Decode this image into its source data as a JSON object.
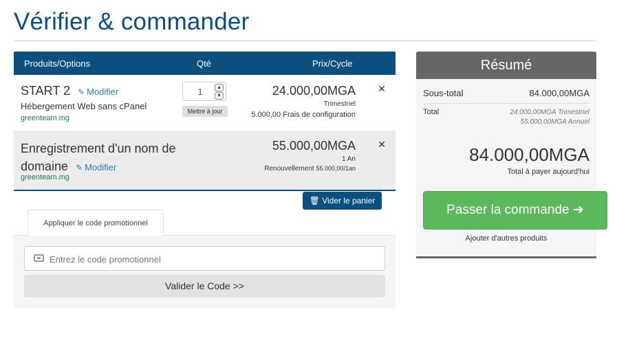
{
  "page": {
    "title": "Vérifier & commander"
  },
  "cart": {
    "headers": {
      "product": "Produits/Options",
      "qty": "Qté",
      "price": "Prix/Cycle"
    },
    "items": [
      {
        "name": "START 2",
        "edit_label": "Modifier",
        "description": "Hébergement Web sans cPanel",
        "domain": "greenteam.mg",
        "qty": "1",
        "update_label": "Mettre à jour",
        "price": "24.000,00MGA",
        "cycle": "Trimestriel",
        "setup_fee": "5.000,00 Frais de configuration",
        "remove_icon": "close-icon"
      },
      {
        "name": "Enregistrement d'un nom de domaine",
        "edit_label": "Modifier",
        "domain": "greenteam.mg",
        "price": "55.000,00MGA",
        "period": "1 An",
        "renewal_label": "Renouvellement",
        "renewal_price": "55.000,00/1an",
        "remove_icon": "close-icon"
      }
    ],
    "empty_label": "Vider le panier"
  },
  "promo": {
    "tab_label": "Appliquer le code promotionnel",
    "placeholder": "Entrez le code promotionnel",
    "validate_label": "Valider le Code >>"
  },
  "summary": {
    "title": "Résumé",
    "subtotal_label": "Sous-total",
    "subtotal_value": "84.000,00MGA",
    "total_label": "Total",
    "recurring_line1": "24.000,00MGA Trimestriel",
    "recurring_line2": "55.000,00MGA Annuel",
    "total_due": "84.000,00MGA",
    "total_caption": "Total à payer aujourd'hui",
    "checkout_label": "Passer la commande",
    "more_products_label": "Ajouter d'autres produits"
  },
  "colors": {
    "brand": "#0a4f7f",
    "checkout": "#5cb85c",
    "summary_header": "#666666",
    "link": "#2a7ab5"
  }
}
